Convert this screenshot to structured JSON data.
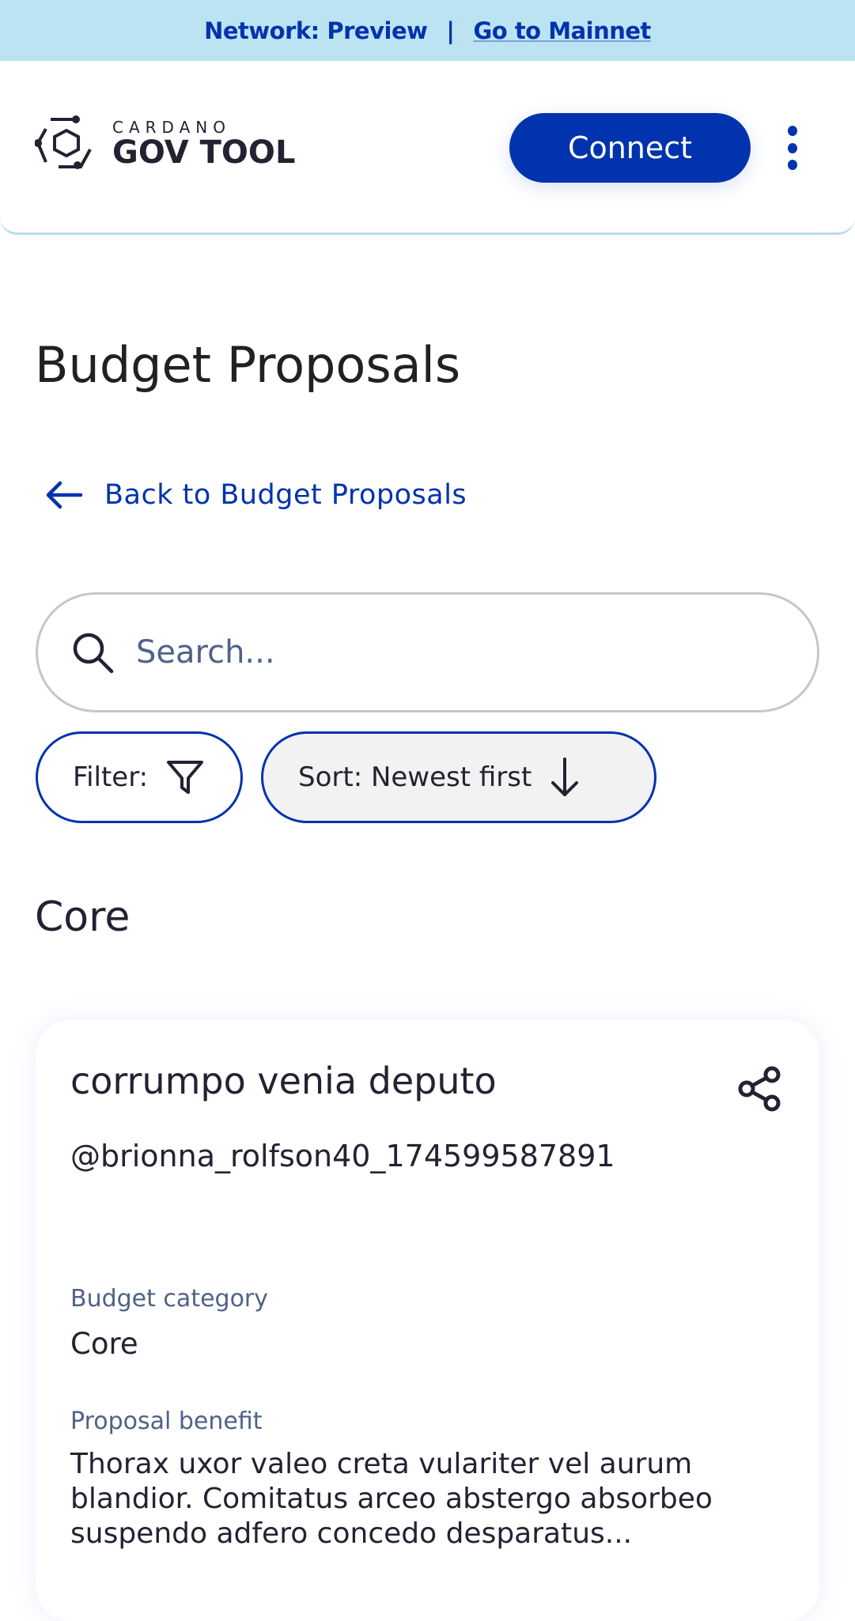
{
  "banner": {
    "network": "Network: Preview",
    "separator": "|",
    "mainnet_link": "Go to Mainnet"
  },
  "header": {
    "logo_top": "CARDANO",
    "logo_bottom": "GOV TOOL",
    "connect": "Connect"
  },
  "page": {
    "title": "Budget Proposals",
    "back": "Back to Budget Proposals"
  },
  "search": {
    "placeholder": "Search..."
  },
  "filter": {
    "label": "Filter:"
  },
  "sort": {
    "label": "Sort: Newest first"
  },
  "section": {
    "title": "Core"
  },
  "card": {
    "title": "corrumpo venia deputo",
    "user": "@brionna_rolfson40_174599587891",
    "category_label": "Budget category",
    "category": "Core",
    "benefit_label": "Proposal benefit",
    "benefit": "Thorax uxor valeo creta vulariter vel aurum blandior. Comitatus arceo abstergo absorbeo suspendo adfero concedo desparatus..."
  }
}
